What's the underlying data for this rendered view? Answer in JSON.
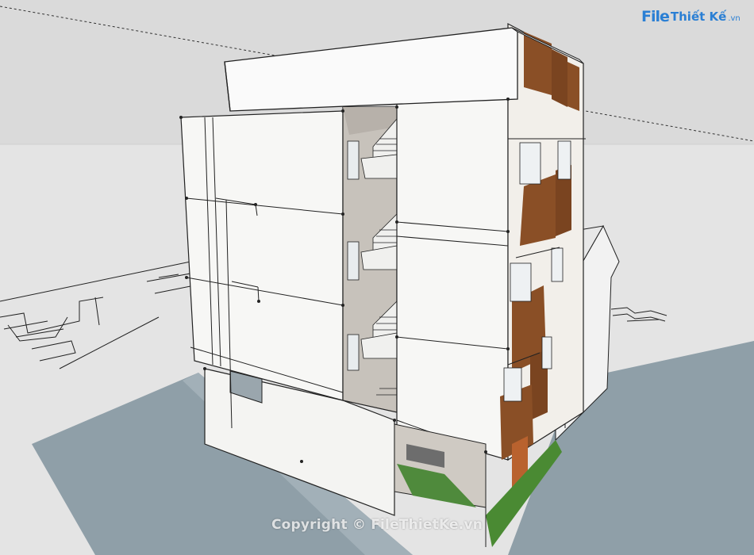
{
  "image": {
    "kind": "3D SketchUp render of a multi-storey townhouse",
    "colors": {
      "sky": "#d9d9d9",
      "ground": "#e6e6e6",
      "road": "#8fa1ab",
      "wall": "#f7f7f5",
      "shadow_wall": "#bdb8b1",
      "wood": "#8a4f26",
      "grass": "#4c8b3b",
      "lines": "#1a1a1a"
    }
  },
  "logo": {
    "file": "File",
    "brand": "Thiết Kế",
    "vn": ".vn"
  },
  "watermark": "Copyright © FileThietKe.vn"
}
